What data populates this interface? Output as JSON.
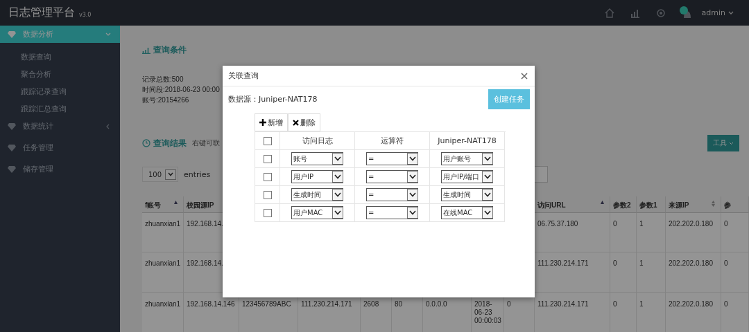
{
  "topbar": {
    "title": "日志管理平台",
    "version": "v3.0",
    "user": "admin"
  },
  "sidebar": {
    "items": [
      {
        "kind": "group",
        "label": "数据分析",
        "expanded": true,
        "selected": true,
        "children": [
          {
            "label": "数据查询"
          },
          {
            "label": "聚合分析"
          },
          {
            "label": "跟踪记录查询"
          },
          {
            "label": "跟踪汇总查询"
          }
        ]
      },
      {
        "kind": "group",
        "label": "数据统计",
        "expanded": false,
        "selected": false
      },
      {
        "kind": "item",
        "label": "任务管理",
        "selected": false
      },
      {
        "kind": "item",
        "label": "储存管理",
        "selected": false
      }
    ]
  },
  "conditions": {
    "title": "查询条件",
    "lines": [
      "记录总数:500",
      "时间段:2018-06-23 00:00",
      "账号:20154266"
    ]
  },
  "results": {
    "title": "查询结果",
    "hint": "右键可联",
    "tools_button": "工具",
    "page_size": "100",
    "entries_label": "entries",
    "table": {
      "columns": [
        {
          "label": "f账号",
          "sorted": true
        },
        {
          "label": "校园源IP"
        },
        null,
        null,
        null,
        null,
        null,
        null,
        null,
        {
          "label": "访问URL",
          "sorted": true
        },
        {
          "label": "参数2"
        },
        {
          "label": "参数1"
        },
        {
          "label": "来源IP",
          "sortable": true
        },
        {
          "label": "参"
        }
      ],
      "rows": [
        {
          "cells": [
            "zhuanxian1",
            "192.168.14.",
            null,
            null,
            null,
            null,
            null,
            null,
            null,
            "06.75.37.180",
            "0",
            "1",
            "202.202.0.180",
            "0"
          ]
        },
        {
          "cells": [
            "zhuanxian1",
            "192.168.14.",
            null,
            null,
            null,
            null,
            null,
            null,
            null,
            "111.230.214.171",
            "0",
            "1",
            "202.202.0.180",
            "0"
          ]
        },
        {
          "cells": [
            "zhuanxian1",
            "192.168.14.146",
            "123456789ABC",
            "111.230.214.171",
            "2608",
            "80",
            "0.0.0.0",
            "2018-06-23 00:00:03",
            "0",
            "111.230.214.171",
            "0",
            "1",
            "202.202.0.180",
            "0"
          ]
        }
      ]
    }
  },
  "dialog": {
    "title": "关联查询",
    "source_label": "数据源：Juniper-NAT178",
    "create_button": "创建任务",
    "add_button": "新增",
    "delete_button": "删除",
    "columns": [
      "访问日志",
      "运算符",
      "Juniper-NAT178"
    ],
    "header_checked": false,
    "rows": [
      {
        "checked": false,
        "values": [
          "账号",
          "=",
          "用户账号"
        ]
      },
      {
        "checked": false,
        "values": [
          "用户IP",
          "=",
          "用户IP/端口"
        ]
      },
      {
        "checked": false,
        "values": [
          "生成时间",
          "=",
          "生成时间"
        ]
      },
      {
        "checked": false,
        "values": [
          "用户MAC",
          "=",
          "在线MAC"
        ]
      }
    ]
  }
}
